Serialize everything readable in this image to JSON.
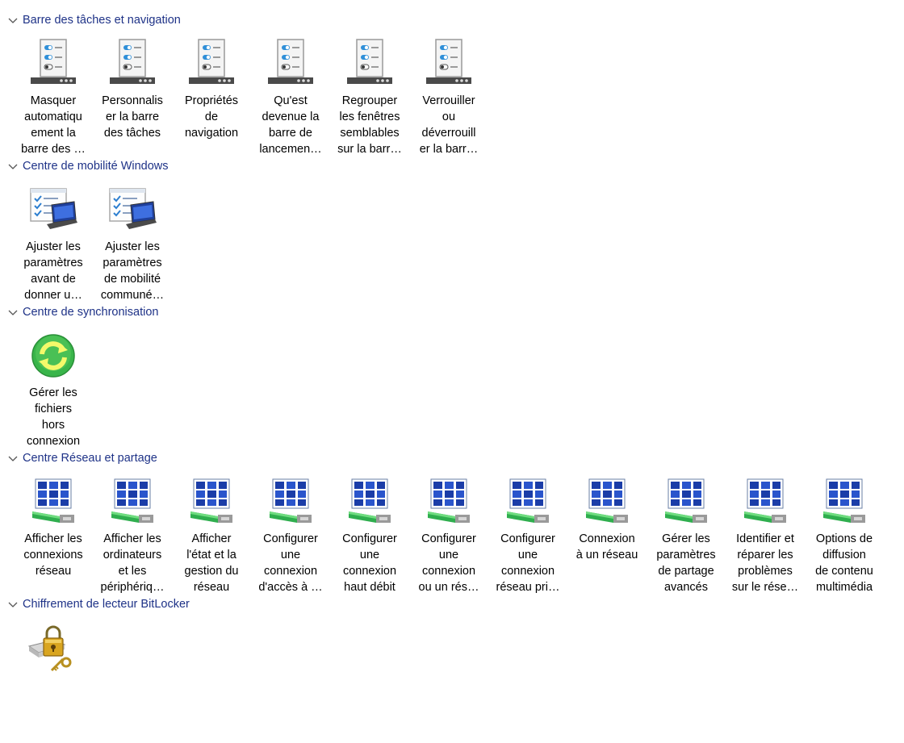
{
  "colors": {
    "header_text": "#1e3287",
    "label_text": "#000000",
    "background": "#ffffff"
  },
  "groups": [
    {
      "title": "Barre des tâches et navigation",
      "icon": "taskbar-settings-icon",
      "items": [
        "Masquer\nautomatiqu\nement la\nbarre des …",
        "Personnalis\ner la barre\ndes tâches",
        "Propriétés\nde\nnavigation",
        "Qu'est\ndevenue la\nbarre de\nlancemen…",
        "Regrouper\nles fenêtres\nsemblables\nsur la barr…",
        "Verrouiller\nou\ndéverrouill\ner la barr…"
      ]
    },
    {
      "title": "Centre de mobilité Windows",
      "icon": "mobility-center-icon",
      "items": [
        "Ajuster les\nparamètres\navant de\ndonner u…",
        "Ajuster les\nparamètres\nde mobilité\ncommuné…"
      ]
    },
    {
      "title": "Centre de synchronisation",
      "icon": "sync-center-icon",
      "items": [
        "Gérer les\nfichiers\nhors\nconnexion"
      ]
    },
    {
      "title": "Centre Réseau et partage",
      "icon": "network-sharing-icon",
      "items": [
        "Afficher les\nconnexions\nréseau",
        "Afficher les\nordinateurs\net les\npériphériq…",
        "Afficher\nl'état et la\ngestion du\nréseau",
        "Configurer\nune\nconnexion\nd'accès à …",
        "Configurer\nune\nconnexion\nhaut débit",
        "Configurer\nune\nconnexion\nou un rés…",
        "Configurer\nune\nconnexion\nréseau pri…",
        "Connexion\nà un réseau",
        "Gérer les\nparamètres\nde partage\navancés",
        "Identifier et\nréparer les\nproblèmes\nsur le rése…",
        "Options de\ndiffusion\nde contenu\nmultimédia"
      ]
    },
    {
      "title": "Chiffrement de lecteur BitLocker",
      "icon": "bitlocker-drive-icon",
      "items": [
        ""
      ]
    }
  ]
}
